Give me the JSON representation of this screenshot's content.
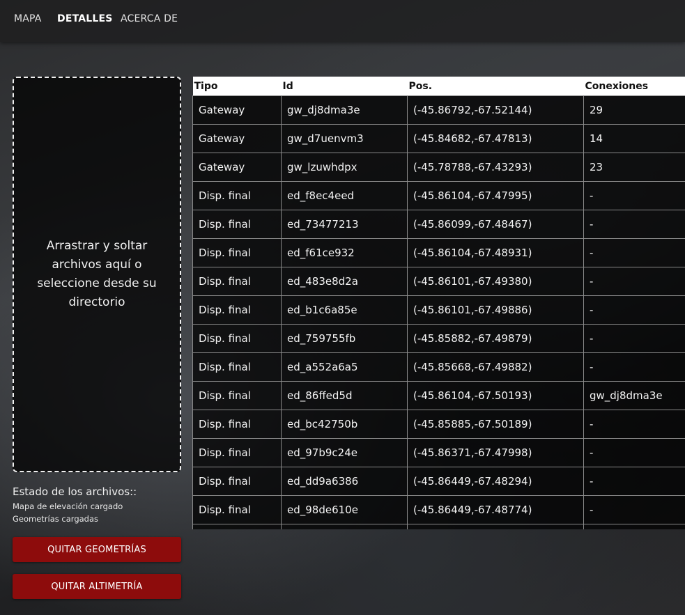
{
  "nav": {
    "items": [
      {
        "label": "MAPA",
        "active": false
      },
      {
        "label": "DETALLES",
        "active": true
      },
      {
        "label": "ACERCA DE",
        "active": false
      }
    ]
  },
  "sidebar": {
    "dropzone_text": "Arrastrar y soltar archivos aquí o seleccione desde su directorio",
    "status_title": "Estado de los archivos::",
    "status_lines": [
      "Mapa de elevación cargado",
      "Geometrías cargadas"
    ],
    "buttons": {
      "remove_geometries": "QUITAR GEOMETRÍAS",
      "remove_altimetry": "QUITAR ALTIMETRÍA"
    }
  },
  "table": {
    "headers": [
      "Tipo",
      "Id",
      "Pos.",
      "Conexiones"
    ],
    "rows": [
      [
        "Gateway",
        "gw_dj8dma3e",
        "(-45.86792,-67.52144)",
        "29"
      ],
      [
        "Gateway",
        "gw_d7uenvm3",
        "(-45.84682,-67.47813)",
        "14"
      ],
      [
        "Gateway",
        "gw_lzuwhdpx",
        "(-45.78788,-67.43293)",
        "23"
      ],
      [
        "Disp. final",
        "ed_f8ec4eed",
        "(-45.86104,-67.47995)",
        "-"
      ],
      [
        "Disp. final",
        "ed_73477213",
        "(-45.86099,-67.48467)",
        "-"
      ],
      [
        "Disp. final",
        "ed_f61ce932",
        "(-45.86104,-67.48931)",
        "-"
      ],
      [
        "Disp. final",
        "ed_483e8d2a",
        "(-45.86101,-67.49380)",
        "-"
      ],
      [
        "Disp. final",
        "ed_b1c6a85e",
        "(-45.86101,-67.49886)",
        "-"
      ],
      [
        "Disp. final",
        "ed_759755fb",
        "(-45.85882,-67.49879)",
        "-"
      ],
      [
        "Disp. final",
        "ed_a552a6a5",
        "(-45.85668,-67.49882)",
        "-"
      ],
      [
        "Disp. final",
        "ed_86ffed5d",
        "(-45.86104,-67.50193)",
        "gw_dj8dma3e"
      ],
      [
        "Disp. final",
        "ed_bc42750b",
        "(-45.85885,-67.50189)",
        "-"
      ],
      [
        "Disp. final",
        "ed_97b9c24e",
        "(-45.86371,-67.47998)",
        "-"
      ],
      [
        "Disp. final",
        "ed_dd9a6386",
        "(-45.86449,-67.48294)",
        "-"
      ],
      [
        "Disp. final",
        "ed_98de610e",
        "(-45.86449,-67.48774)",
        "-"
      ]
    ]
  }
}
